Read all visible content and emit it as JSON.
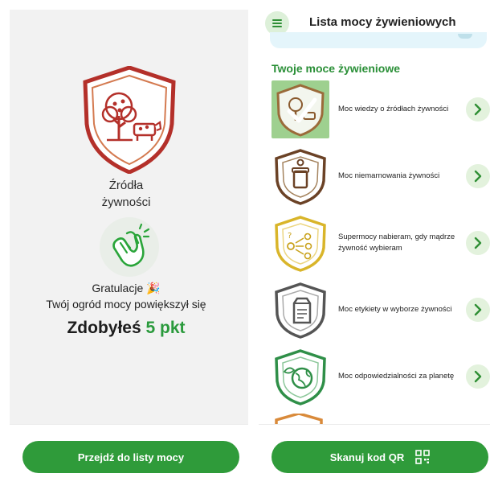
{
  "left_screen": {
    "badge_title_line1": "Źródła",
    "badge_title_line2": "żywności",
    "congrats": "Gratulacje",
    "congrats_emoji": "🎉",
    "garden_text": "Twój ogród mocy powiększył się",
    "points_prefix": "Zdobyłeś",
    "points_value": "5 pkt",
    "button_label": "Przejdź do listy mocy"
  },
  "right_screen": {
    "title": "Lista mocy żywieniowych",
    "section_title": "Twoje moce żywieniowe",
    "powers": [
      {
        "label": "Moc wiedzy o źródłach żywności",
        "icon": "tree-cow-icon",
        "color": "#9b6b3a",
        "active": true
      },
      {
        "label": "Moc niemarnowania żywności",
        "icon": "jar-icon",
        "color": "#6b4226",
        "active": false
      },
      {
        "label": "Supermocy nabieram, gdy mądrze żywność wybieram",
        "icon": "choice-icon",
        "color": "#d9b52a",
        "active": false
      },
      {
        "label": "Moc etykiety w wyborze żywności",
        "icon": "milk-carton-icon",
        "color": "#555555",
        "active": false
      },
      {
        "label": "Moc odpowiedzialności za planetę",
        "icon": "globe-leaf-icon",
        "color": "#2f8f48",
        "active": false
      }
    ],
    "button_label": "Skanuj kod QR"
  },
  "colors": {
    "primary_green": "#2f9b3a",
    "accent_green": "#2a8f37",
    "badge_red": "#b4302a"
  }
}
